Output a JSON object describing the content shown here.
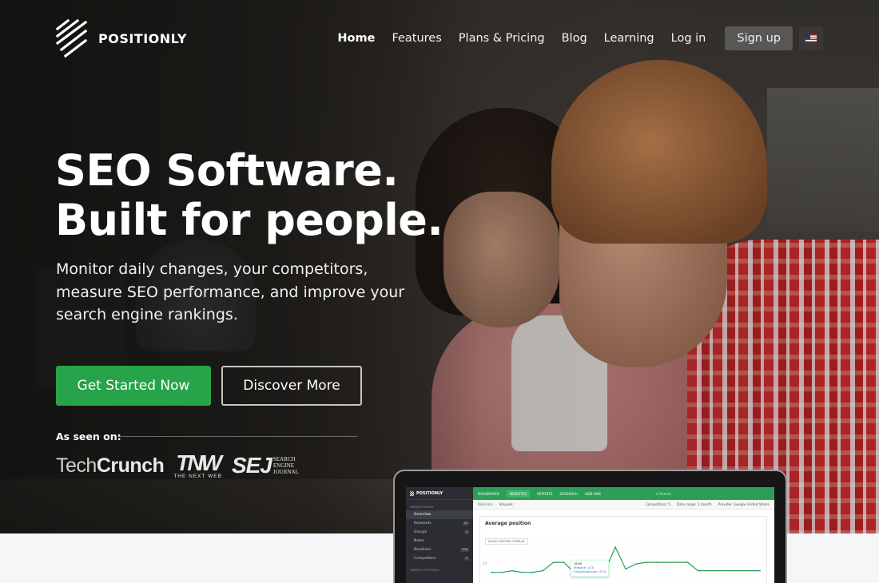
{
  "brand": {
    "name": "POSITIONLY"
  },
  "nav": {
    "items": [
      {
        "label": "Home",
        "active": true
      },
      {
        "label": "Features",
        "active": false
      },
      {
        "label": "Plans & Pricing",
        "active": false
      },
      {
        "label": "Blog",
        "active": false
      },
      {
        "label": "Learning",
        "active": false
      },
      {
        "label": "Log in",
        "active": false
      }
    ],
    "signup_label": "Sign up",
    "language_icon": "us-flag-icon"
  },
  "hero": {
    "headline_line1": "SEO Software.",
    "headline_line2": "Built for people.",
    "subhead": "Monitor daily changes, your competitors, measure SEO performance, and improve your search engine rankings.",
    "cta_primary": "Get Started Now",
    "cta_secondary": "Discover More",
    "as_seen_on": "As seen on:",
    "press": {
      "techcrunch_a": "Tech",
      "techcrunch_b": "Crunch",
      "tnw": "TNW",
      "tnw_sub": "THE NEXT WEB",
      "sej": "SEJ",
      "sej_sub1": "SEARCH",
      "sej_sub2": "ENGINE",
      "sej_sub3": "JOURNAL"
    }
  },
  "colors": {
    "primary_green": "#27a349",
    "dashboard_green": "#2b9f57"
  },
  "dashboard": {
    "brand": "POSITIONLY",
    "menu_section": "WEBSITE MENU",
    "menu": [
      {
        "label": "Overview",
        "count": ""
      },
      {
        "label": "Keywords",
        "count": "43"
      },
      {
        "label": "Groups",
        "count": "3"
      },
      {
        "label": "Notes",
        "count": ""
      },
      {
        "label": "Backlinks",
        "count": "996"
      },
      {
        "label": "Competitors",
        "count": "5"
      }
    ],
    "settings_section": "WEBSITE SETTINGS",
    "tabs": [
      "DASHBOARD",
      "WEBSITES",
      "REPORTS",
      "RESEARCH",
      "ADD-ONS"
    ],
    "active_tab": "WEBSITES",
    "search_placeholder": "Search",
    "breadcrumb_root": "Websites",
    "breadcrumb_current": "Stepank",
    "filter_competitors": "Competitors: 5",
    "filter_range": "Date range: 1 month",
    "filter_provider": "Provider: Google United States",
    "card_title": "Average position",
    "card_option": "SHOW VISITORS OVERLAY",
    "axis_label": "20",
    "tooltip_date": "28/06",
    "tooltip_series1": "Stepank: 13.0",
    "tooltip_series2": "Outputcopy.com: 47.6",
    "series_values": [
      22,
      22,
      21,
      22,
      22,
      21,
      16,
      16,
      22,
      19,
      22,
      21,
      7,
      20,
      17,
      16,
      16,
      16,
      16,
      16,
      21,
      21,
      21,
      21,
      21,
      21,
      21
    ]
  }
}
